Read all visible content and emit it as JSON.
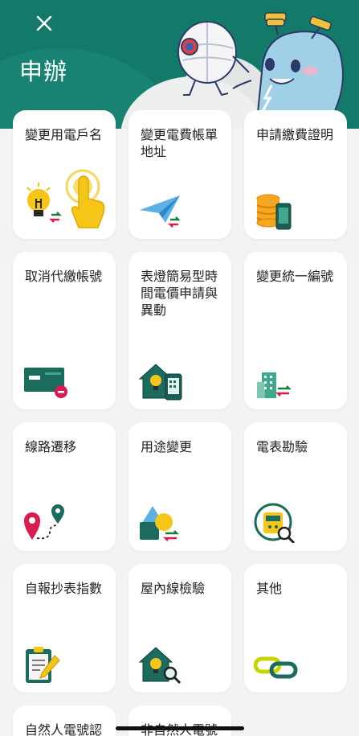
{
  "header": {
    "title": "申辦"
  },
  "cards": [
    {
      "label": "變更用電戶名",
      "icon": "bulb-transfer-icon"
    },
    {
      "label": "變更電費帳單地址",
      "icon": "paper-plane-icon"
    },
    {
      "label": "申請繳費證明",
      "icon": "coins-phone-icon"
    },
    {
      "label": "取消代繳帳號",
      "icon": "card-remove-icon"
    },
    {
      "label": "表燈簡易型時間電價申請與異動",
      "icon": "house-phone-icon"
    },
    {
      "label": "變更統一編號",
      "icon": "building-transfer-icon"
    },
    {
      "label": "線路遷移",
      "icon": "location-pins-icon"
    },
    {
      "label": "用途變更",
      "icon": "shapes-transfer-icon"
    },
    {
      "label": "電表勘驗",
      "icon": "meter-inspect-icon"
    },
    {
      "label": "自報抄表指數",
      "icon": "clipboard-pen-icon"
    },
    {
      "label": "屋內線檢驗",
      "icon": "house-inspect-icon"
    },
    {
      "label": "其他",
      "icon": "chain-link-icon"
    },
    {
      "label": "自然人電號認",
      "icon": ""
    },
    {
      "label": "非自然人電號",
      "icon": ""
    }
  ],
  "colors": {
    "brand_green": "#137a6a",
    "accent_yellow": "#f5c518",
    "accent_red": "#d81b50",
    "card_bg": "#ffffff",
    "page_bg": "#f2f2f2"
  }
}
